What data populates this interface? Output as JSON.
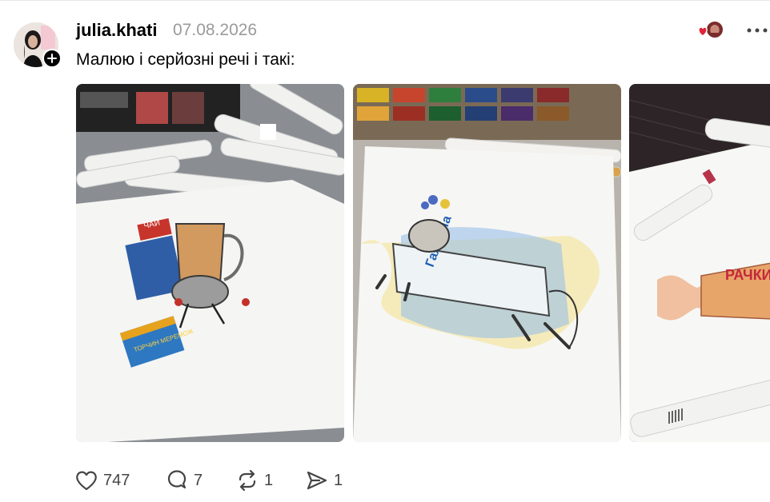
{
  "post": {
    "username": "julia.khati",
    "date": "07.08.2026",
    "caption": "Малюю і серйозні речі і такі:"
  },
  "photos": [
    {
      "name": "tea-drawing"
    },
    {
      "name": "cow-yogurt-drawing"
    },
    {
      "name": "candy-drawing"
    }
  ],
  "photo_text": {
    "tea_box": "ЧАЙ",
    "chocolate": "ТОРЧИН МЕРЕМОЖ",
    "yogurt_brand": "Гаяжина",
    "candy": "РАЧКИ"
  },
  "actions": {
    "likes": "747",
    "replies": "7",
    "reposts": "1",
    "shares": "1"
  },
  "colors": {
    "text": "#000000",
    "muted": "#9a9a9a",
    "icon": "#444444",
    "reaction_red": "#e0243a"
  }
}
